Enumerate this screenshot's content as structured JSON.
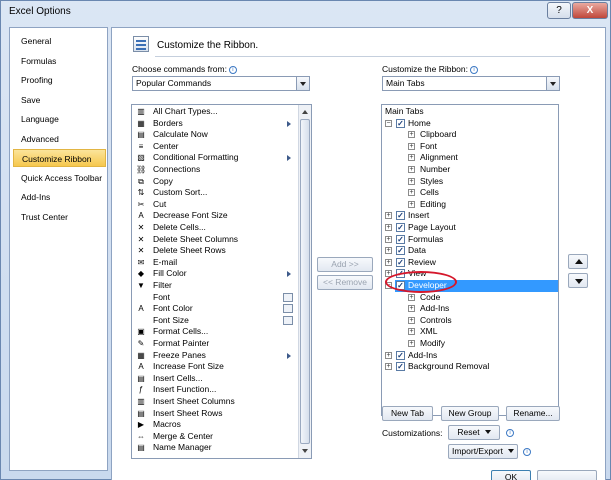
{
  "window": {
    "title": "Excel Options",
    "help_glyph": "?",
    "close_glyph": "X"
  },
  "nav": {
    "items": [
      "General",
      "Formulas",
      "Proofing",
      "Save",
      "Language",
      "Advanced",
      "Customize Ribbon",
      "Quick Access Toolbar",
      "Add-Ins",
      "Trust Center"
    ],
    "selected": "Customize Ribbon"
  },
  "header": {
    "title": "Customize the Ribbon."
  },
  "left": {
    "label": "Choose commands from:",
    "combo_value": "Popular Commands",
    "commands": [
      {
        "label": "All Chart Types...",
        "icon": "chart-icon",
        "glyph": "▥",
        "marker": ""
      },
      {
        "label": "Borders",
        "icon": "borders-icon",
        "glyph": "▦",
        "marker": "submenu"
      },
      {
        "label": "Calculate Now",
        "icon": "calculator-icon",
        "glyph": "▤",
        "marker": ""
      },
      {
        "label": "Center",
        "icon": "center-align-icon",
        "glyph": "≡",
        "marker": ""
      },
      {
        "label": "Conditional Formatting",
        "icon": "conditional-formatting-icon",
        "glyph": "▧",
        "marker": "submenu"
      },
      {
        "label": "Connections",
        "icon": "connections-icon",
        "glyph": "⛓",
        "marker": ""
      },
      {
        "label": "Copy",
        "icon": "copy-icon",
        "glyph": "⧉",
        "marker": ""
      },
      {
        "label": "Custom Sort...",
        "icon": "sort-icon",
        "glyph": "⇅",
        "marker": ""
      },
      {
        "label": "Cut",
        "icon": "scissors-icon",
        "glyph": "✂",
        "marker": ""
      },
      {
        "label": "Decrease Font Size",
        "icon": "decrease-font-icon",
        "glyph": "A",
        "marker": ""
      },
      {
        "label": "Delete Cells...",
        "icon": "delete-cells-icon",
        "glyph": "✕",
        "marker": ""
      },
      {
        "label": "Delete Sheet Columns",
        "icon": "delete-columns-icon",
        "glyph": "✕",
        "marker": ""
      },
      {
        "label": "Delete Sheet Rows",
        "icon": "delete-rows-icon",
        "glyph": "✕",
        "marker": ""
      },
      {
        "label": "E-mail",
        "icon": "email-icon",
        "glyph": "✉",
        "marker": ""
      },
      {
        "label": "Fill Color",
        "icon": "fill-color-icon",
        "glyph": "◆",
        "marker": "submenu"
      },
      {
        "label": "Filter",
        "icon": "filter-icon",
        "glyph": "▼",
        "marker": ""
      },
      {
        "label": "Font",
        "icon": "font-icon",
        "glyph": "",
        "marker": "split"
      },
      {
        "label": "Font Color",
        "icon": "font-color-icon",
        "glyph": "A",
        "marker": "split"
      },
      {
        "label": "Font Size",
        "icon": "font-size-icon",
        "glyph": "",
        "marker": "split"
      },
      {
        "label": "Format Cells...",
        "icon": "format-cells-icon",
        "glyph": "▣",
        "marker": ""
      },
      {
        "label": "Format Painter",
        "icon": "format-painter-icon",
        "glyph": "✎",
        "marker": ""
      },
      {
        "label": "Freeze Panes",
        "icon": "freeze-panes-icon",
        "glyph": "▦",
        "marker": "submenu"
      },
      {
        "label": "Increase Font Size",
        "icon": "increase-font-icon",
        "glyph": "A",
        "marker": ""
      },
      {
        "label": "Insert Cells...",
        "icon": "insert-cells-icon",
        "glyph": "▤",
        "marker": ""
      },
      {
        "label": "Insert Function...",
        "icon": "function-icon",
        "glyph": "ƒ",
        "marker": ""
      },
      {
        "label": "Insert Sheet Columns",
        "icon": "insert-columns-icon",
        "glyph": "▥",
        "marker": ""
      },
      {
        "label": "Insert Sheet Rows",
        "icon": "insert-rows-icon",
        "glyph": "▤",
        "marker": ""
      },
      {
        "label": "Macros",
        "icon": "macros-icon",
        "glyph": "▶",
        "marker": ""
      },
      {
        "label": "Merge & Center",
        "icon": "merge-center-icon",
        "glyph": "⇔",
        "marker": ""
      },
      {
        "label": "Name Manager",
        "icon": "name-manager-icon",
        "glyph": "▤",
        "marker": ""
      }
    ]
  },
  "middle": {
    "add_label": "Add >>",
    "remove_label": "<< Remove"
  },
  "right": {
    "label": "Customize the Ribbon:",
    "combo_value": "Main Tabs",
    "tree": [
      {
        "label": "Main Tabs",
        "level": "header",
        "expander": "",
        "checked": false,
        "selected": false
      },
      {
        "label": "Home",
        "level": "tab",
        "expander": "−",
        "checked": true,
        "selected": false
      },
      {
        "label": "Clipboard",
        "level": "group",
        "expander": "+",
        "checked": false,
        "selected": false
      },
      {
        "label": "Font",
        "level": "group",
        "expander": "+",
        "checked": false,
        "selected": false
      },
      {
        "label": "Alignment",
        "level": "group",
        "expander": "+",
        "checked": false,
        "selected": false
      },
      {
        "label": "Number",
        "level": "group",
        "expander": "+",
        "checked": false,
        "selected": false
      },
      {
        "label": "Styles",
        "level": "group",
        "expander": "+",
        "checked": false,
        "selected": false
      },
      {
        "label": "Cells",
        "level": "group",
        "expander": "+",
        "checked": false,
        "selected": false
      },
      {
        "label": "Editing",
        "level": "group",
        "expander": "+",
        "checked": false,
        "selected": false
      },
      {
        "label": "Insert",
        "level": "tab",
        "expander": "+",
        "checked": true,
        "selected": false
      },
      {
        "label": "Page Layout",
        "level": "tab",
        "expander": "+",
        "checked": true,
        "selected": false
      },
      {
        "label": "Formulas",
        "level": "tab",
        "expander": "+",
        "checked": true,
        "selected": false
      },
      {
        "label": "Data",
        "level": "tab",
        "expander": "+",
        "checked": true,
        "selected": false
      },
      {
        "label": "Review",
        "level": "tab",
        "expander": "+",
        "checked": true,
        "selected": false
      },
      {
        "label": "View",
        "level": "tab",
        "expander": "+",
        "checked": true,
        "selected": false
      },
      {
        "label": "Developer",
        "level": "tab",
        "expander": "−",
        "checked": true,
        "selected": true
      },
      {
        "label": "Code",
        "level": "group",
        "expander": "+",
        "checked": false,
        "selected": false
      },
      {
        "label": "Add-Ins",
        "level": "group",
        "expander": "+",
        "checked": false,
        "selected": false
      },
      {
        "label": "Controls",
        "level": "group",
        "expander": "+",
        "checked": false,
        "selected": false
      },
      {
        "label": "XML",
        "level": "group",
        "expander": "+",
        "checked": false,
        "selected": false
      },
      {
        "label": "Modify",
        "level": "group",
        "expander": "+",
        "checked": false,
        "selected": false
      },
      {
        "label": "Add-Ins",
        "level": "tab",
        "expander": "+",
        "checked": true,
        "selected": false
      },
      {
        "label": "Background Removal",
        "level": "tab",
        "expander": "+",
        "checked": true,
        "selected": false
      }
    ],
    "new_tab_label": "New Tab",
    "new_group_label": "New Group",
    "rename_label": "Rename...",
    "customizations_label": "Customizations:",
    "reset_label": "Reset",
    "import_export_label": "Import/Export"
  },
  "footer": {
    "ok_label": "OK"
  },
  "colors": {
    "selection": "#3399ff",
    "highlight_ring": "#d5172b",
    "nav_selected": "#f6c84e"
  }
}
